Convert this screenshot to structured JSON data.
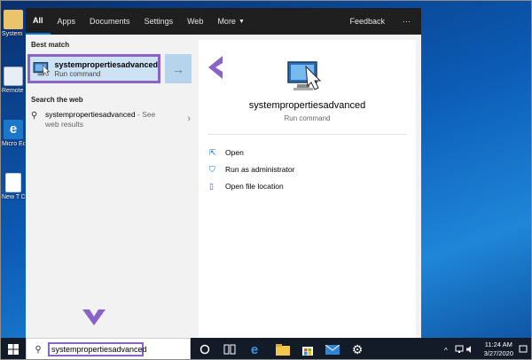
{
  "desktop": {
    "icons": [
      {
        "label": "System"
      },
      {
        "label": "Remote Applic"
      },
      {
        "label": "Micro Edg"
      },
      {
        "label": "New T Docume"
      }
    ]
  },
  "search_tabs": [
    {
      "label": "All"
    },
    {
      "label": "Apps"
    },
    {
      "label": "Documents"
    },
    {
      "label": "Settings"
    },
    {
      "label": "Web"
    },
    {
      "label": "More"
    }
  ],
  "feedback_label": "Feedback",
  "more_options_label": "···",
  "best_match": {
    "section_title": "Best match",
    "title": "systempropertiesadvanced",
    "subtitle": "Run command"
  },
  "search_web": {
    "section_title": "Search the web",
    "query": "systempropertiesadvanced",
    "suffix": " - See",
    "line2": "web results"
  },
  "preview": {
    "title": "systempropertiesadvanced",
    "subtitle": "Run command",
    "actions": [
      {
        "label": "Open"
      },
      {
        "label": "Run as administrator"
      },
      {
        "label": "Open file location"
      }
    ]
  },
  "taskbar": {
    "search_value": "systempropertiesadvanced",
    "time": "11:24 AM",
    "date": "3/27/2020"
  },
  "colors": {
    "accent": "#0078d7",
    "annotation": "#8a63c9",
    "highlight": "#cde3f5"
  }
}
